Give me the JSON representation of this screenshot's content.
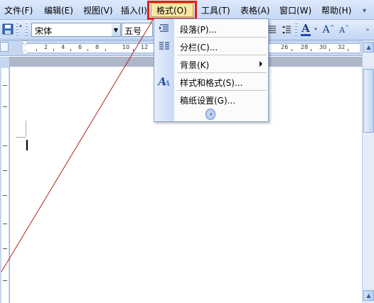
{
  "menubar": {
    "items": [
      {
        "label": "文件(F)"
      },
      {
        "label": "编辑(E)"
      },
      {
        "label": "视图(V)"
      },
      {
        "label": "插入(I)"
      },
      {
        "label": "格式(O)"
      },
      {
        "label": "工具(T)"
      },
      {
        "label": "表格(A)"
      },
      {
        "label": "窗口(W)"
      },
      {
        "label": "帮助(H)"
      }
    ]
  },
  "toolbar": {
    "font_name": "宋体",
    "font_size": "五号",
    "font_color_glyph": "A",
    "grow_font_glyph": "A",
    "shrink_font_glyph": "A",
    "icons": [
      "save-icon",
      "paragraph-align-icon",
      "line-spacing-icon",
      "font-color-icon",
      "grow-font-icon",
      "shrink-font-icon"
    ]
  },
  "ruler": {
    "numbers": [
      "2",
      "4",
      "6",
      "8",
      "10",
      "12",
      "26",
      "28",
      "30",
      "32"
    ]
  },
  "format_menu": {
    "items": [
      {
        "label": "段落(P)...",
        "icon": "paragraph-icon"
      },
      {
        "label": "分栏(C)...",
        "icon": "columns-icon"
      },
      {
        "label": "背景(K)",
        "icon": "",
        "submenu": true
      },
      {
        "label": "样式和格式(S)...",
        "icon": "styles-icon"
      },
      {
        "label": "稿纸设置(G)...",
        "icon": ""
      }
    ],
    "expand_glyph": "»",
    "styles_icon_glyph": "A"
  },
  "colors": {
    "highlight": "#e0201b",
    "menu_active": "#fbe6a6",
    "toolbar_bg": "#c3d6f3"
  }
}
